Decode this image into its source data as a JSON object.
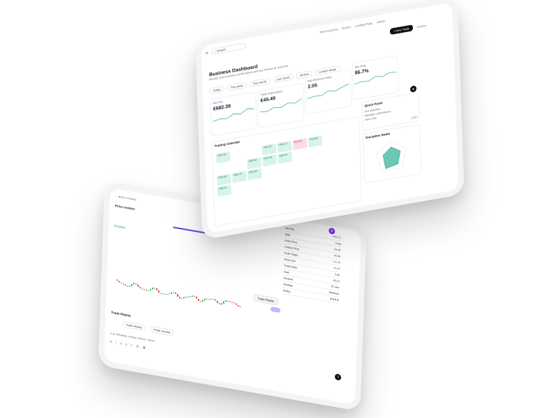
{
  "front": {
    "topbar": {
      "search_placeholder": "Search...",
      "account": "Main Accounts",
      "nav": [
        "Rooms",
        "Landing Page",
        "Library"
      ],
      "new_trade": "+ New Trade",
      "archive": "Archive"
    },
    "title": "Business Dashboard",
    "subtitle": "Monitor your business performance and key metrics at real-time",
    "filters": [
      "Today",
      "This week",
      "This month",
      "Last month",
      "All time",
      "Custom range"
    ],
    "kpis": [
      {
        "label": "Net P&L",
        "value": "€682.39"
      },
      {
        "label": "Trade Expectancy",
        "value": "€45.49"
      },
      {
        "label": "Avg Win/Loss Ratio",
        "value": "2.05"
      },
      {
        "label": "Win Rate",
        "value": "86.7%"
      }
    ],
    "quick_panel": {
      "title": "Quick Panel",
      "items": [
        "Set watchlist",
        "Manage notifications",
        "New note"
      ],
      "value": "0.00"
    },
    "discipline": {
      "title": "Discipline Radar"
    },
    "calendar": {
      "title": "Trading Calendar",
      "cells": [
        {
          "kind": "win",
          "label": "+€35.30"
        },
        {
          "kind": "",
          "label": ""
        },
        {
          "kind": "",
          "label": ""
        },
        {
          "kind": "win",
          "label": "+€61.20"
        },
        {
          "kind": "win",
          "label": "+€44.10"
        },
        {
          "kind": "loss",
          "label": "-€23.80"
        },
        {
          "kind": "win",
          "label": "+€18.90"
        },
        {
          "kind": "",
          "label": ""
        },
        {
          "kind": "",
          "label": ""
        },
        {
          "kind": "win",
          "label": "+€52.60"
        },
        {
          "kind": "win",
          "label": "+€37.40"
        },
        {
          "kind": "win",
          "label": "+€29.00"
        },
        {
          "kind": "",
          "label": ""
        },
        {
          "kind": "",
          "label": ""
        },
        {
          "kind": "win",
          "label": "+€40.50"
        },
        {
          "kind": "win",
          "label": "+€22.70"
        },
        {
          "kind": "win",
          "label": "+€31.80"
        },
        {
          "kind": "",
          "label": ""
        },
        {
          "kind": "",
          "label": ""
        },
        {
          "kind": "",
          "label": ""
        },
        {
          "kind": "",
          "label": ""
        },
        {
          "kind": "win",
          "label": "+€88.10"
        },
        {
          "kind": "",
          "label": ""
        },
        {
          "kind": "",
          "label": ""
        },
        {
          "kind": "",
          "label": ""
        },
        {
          "kind": "",
          "label": ""
        },
        {
          "kind": "",
          "label": ""
        },
        {
          "kind": "",
          "label": ""
        }
      ]
    }
  },
  "back": {
    "back_link": "Back to trades",
    "section": "Price context",
    "position": "Position",
    "tabs": [
      "Trade Replay",
      "Trade Journal"
    ],
    "replay_title": "Trade Replay",
    "notes_placeholder": "e.g. Breakout, strong volume, trend...",
    "replay_button": "Trade Replay",
    "stats": [
      {
        "k": "Net P&L",
        "v": "+€68.22",
        "cls": "pos"
      },
      {
        "k": "Side",
        "v": "Long",
        "cls": ""
      },
      {
        "k": "Entry Price",
        "v": "€1.24",
        "cls": ""
      },
      {
        "k": "Position Size",
        "v": "€1.36",
        "cls": ""
      },
      {
        "k": "Profit Target",
        "v": "+€2.08",
        "cls": "pos"
      },
      {
        "k": "Stop Loss",
        "v": "-€0.35",
        "cls": "neg"
      },
      {
        "k": "Trade Ratio",
        "v": "3.00",
        "cls": ""
      },
      {
        "k": "Fees",
        "v": "€0.12",
        "cls": ""
      },
      {
        "k": "Duration",
        "v": "2h 14m",
        "cls": ""
      },
      {
        "k": "Strategy",
        "v": "Breakout",
        "cls": ""
      },
      {
        "k": "Rating",
        "v": "★★★★",
        "cls": ""
      }
    ]
  }
}
